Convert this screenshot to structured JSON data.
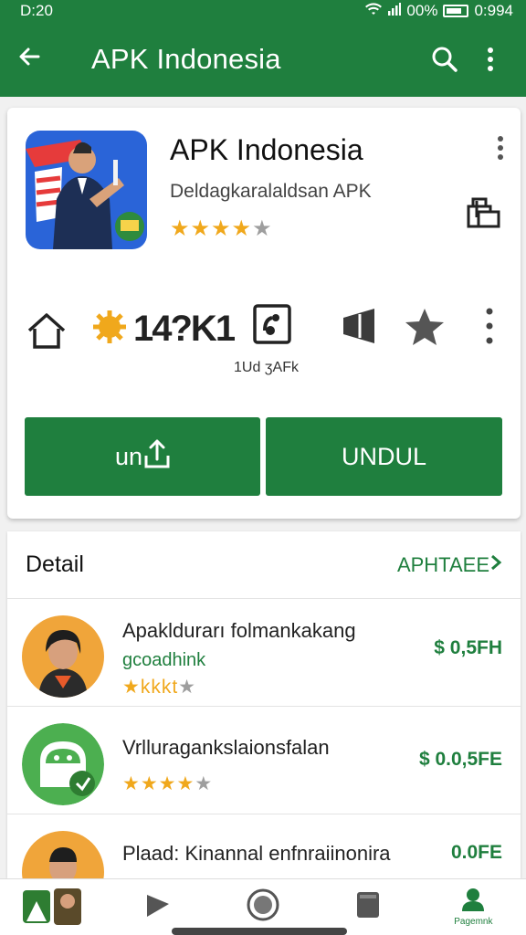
{
  "status_bar": {
    "time": "D:20",
    "battery": "00%",
    "clock_right": "0:994"
  },
  "app_bar": {
    "title": "APK Indonesia"
  },
  "app": {
    "name": "APK Indonesia",
    "developer": "Deldagkaralaldsan APK",
    "rating_stars": 4,
    "metric_value": "14?K1",
    "size_label": "1Ud ʒAFk"
  },
  "buttons": {
    "install": "un",
    "unduh": "UNDUL"
  },
  "detail": {
    "heading": "Detail",
    "more_link": "APHTAEE",
    "items": [
      {
        "title": "Apakldurarı folmankakang",
        "subtitle": "gcoadhink",
        "stars_text": "kkkt",
        "price": "$ 0,5FH"
      },
      {
        "title": "Vrlluragankslaionsfalan",
        "subtitle": "",
        "stars_text": "",
        "price": "$ 0.0,5FE"
      },
      {
        "title": "Plaad: Kinannal enfnraiinonira",
        "subtitle": "",
        "stars_text": "",
        "price": "0.0FE"
      }
    ]
  },
  "bottom_nav": {
    "active_label": "Pagemnk"
  },
  "colors": {
    "primary": "#1f7f3e",
    "star": "#f0a81c"
  }
}
